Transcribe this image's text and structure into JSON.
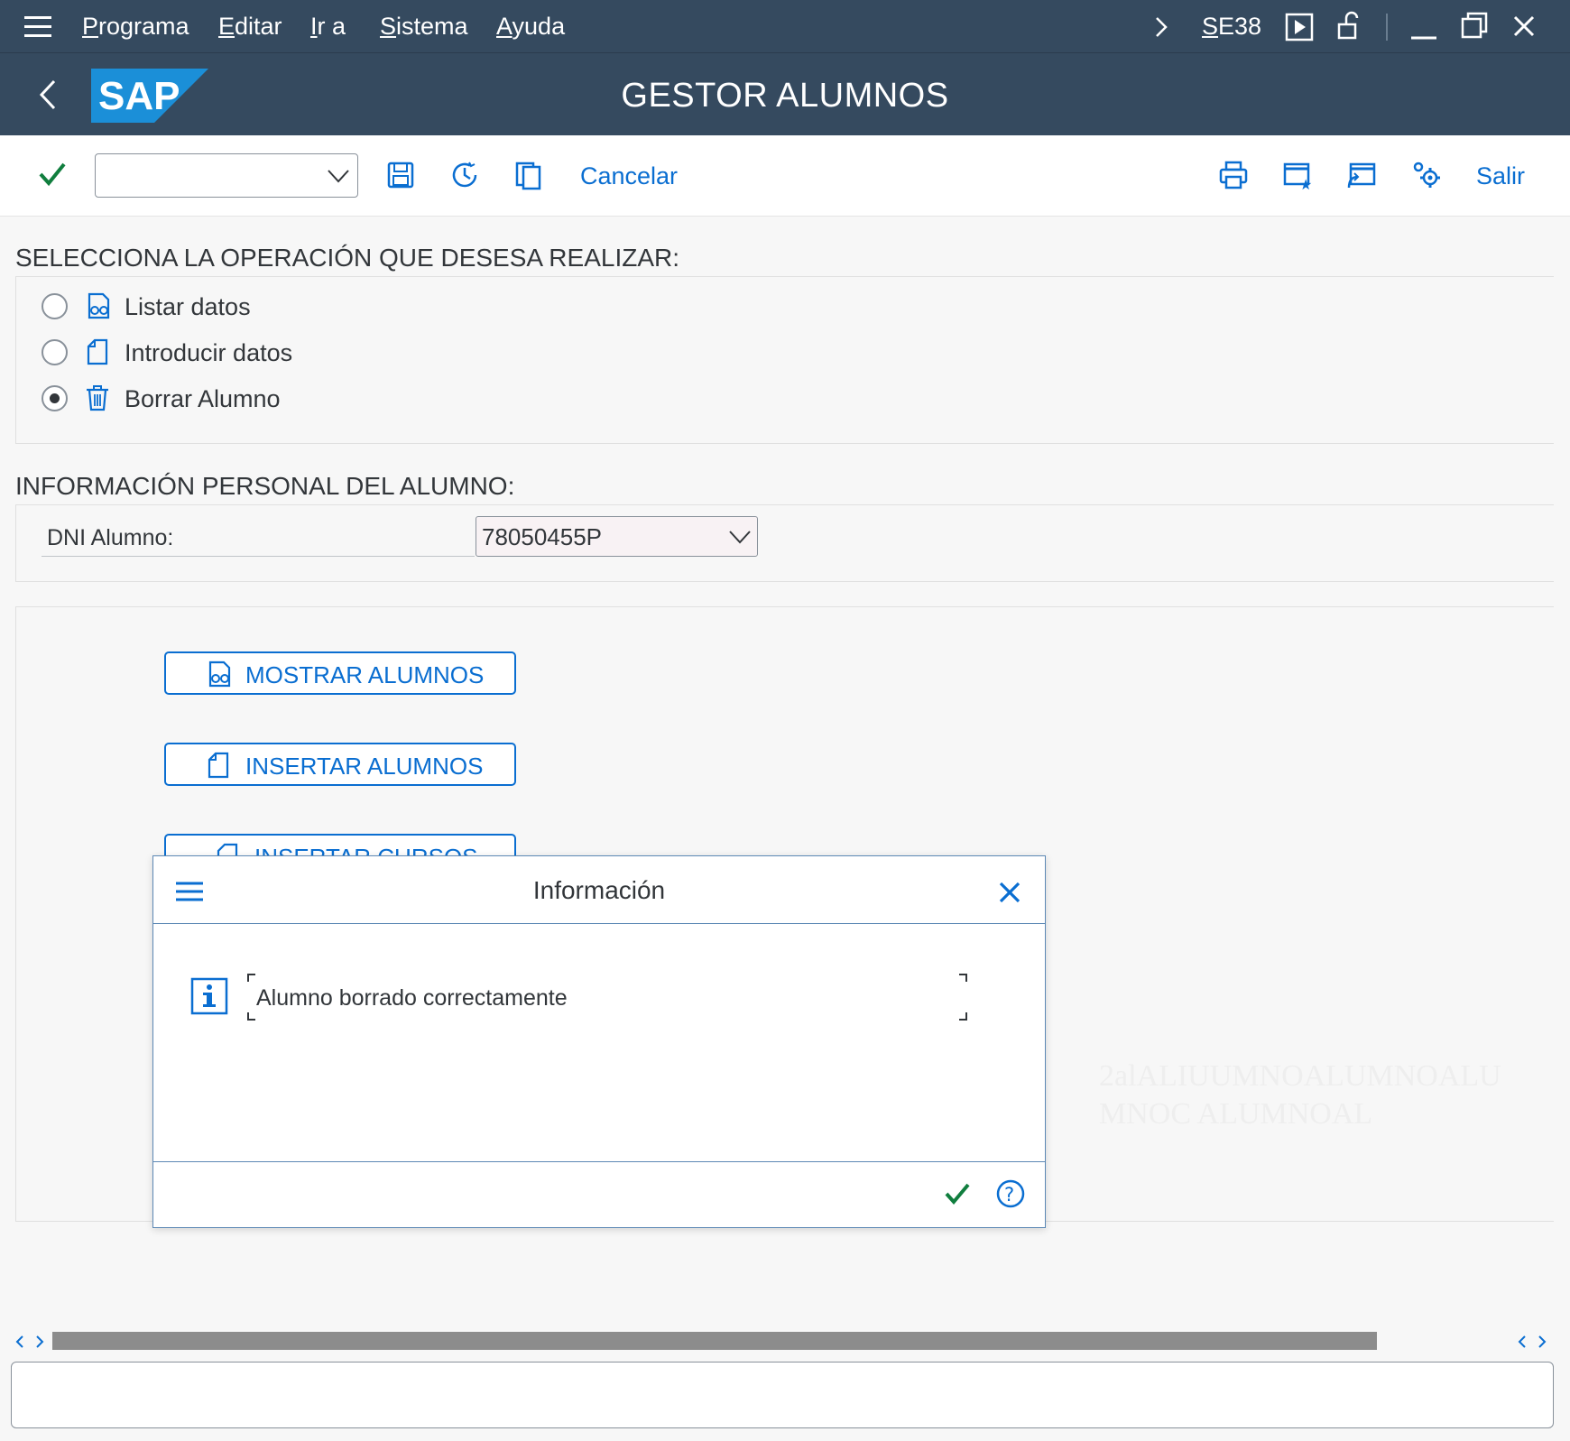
{
  "menubar": {
    "items": [
      "Programa",
      "Editar",
      "Ir a",
      "Sistema",
      "Ayuda"
    ],
    "transaction": "SE38"
  },
  "header": {
    "logo_text": "SAP",
    "title": "GESTOR ALUMNOS"
  },
  "toolbar": {
    "command_field_value": "",
    "cancel_label": "Cancelar",
    "exit_label": "Salir"
  },
  "operation_section": {
    "title": "SELECCIONA LA OPERACIÓN QUE DESESA REALIZAR:",
    "options": [
      {
        "label": "Listar datos",
        "icon": "glasses-document-icon",
        "selected": false
      },
      {
        "label": "Introducir datos",
        "icon": "document-icon",
        "selected": false
      },
      {
        "label": "Borrar Alumno",
        "icon": "trash-icon",
        "selected": true
      }
    ]
  },
  "personal_section": {
    "title": "INFORMACIÓN PERSONAL DEL ALUMNO:",
    "dni_label": "DNI Alumno:",
    "dni_value": "78050455P"
  },
  "buttons": [
    {
      "label": "MOSTRAR ALUMNOS",
      "icon": "glasses-document-icon"
    },
    {
      "label": "INSERTAR ALUMNOS",
      "icon": "document-icon"
    },
    {
      "label": "INSERTAR CURSOS",
      "icon": "document-icon"
    }
  ],
  "dialog": {
    "title": "Información",
    "message": "Alumno borrado correctamente"
  },
  "background_text": {
    "line1": "2alALIUUMNOALUMNOALU",
    "line2": "MNOC ALUMNOAL"
  },
  "colors": {
    "shell": "#354a5f",
    "accent": "#0a6ed1",
    "confirm": "#107e3e",
    "background": "#f7f7f7"
  }
}
